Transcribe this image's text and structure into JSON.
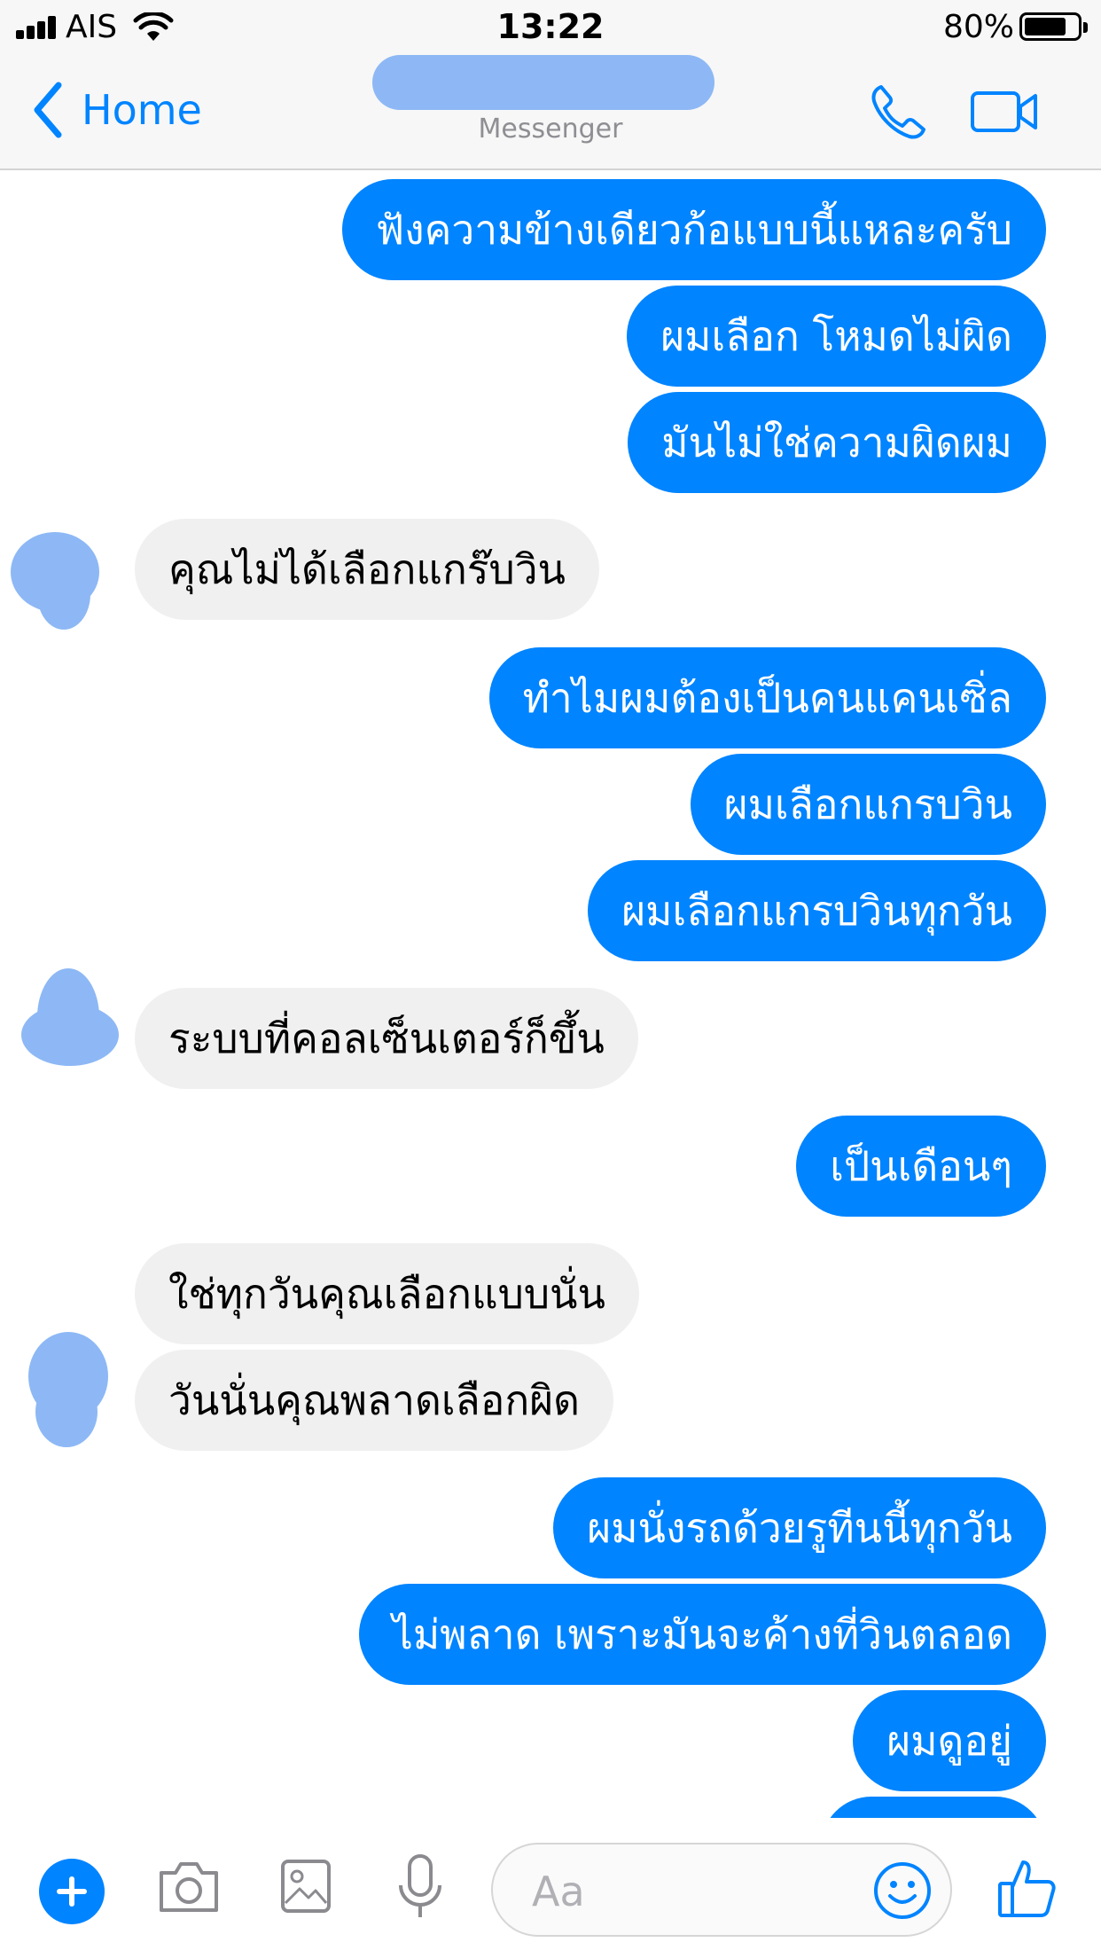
{
  "status_bar": {
    "carrier": "AIS",
    "time": "13:22",
    "battery_percent": "80%",
    "battery_level": 0.8
  },
  "nav": {
    "back_label": "Home",
    "subtitle": "Messenger"
  },
  "messages": [
    {
      "side": "out",
      "text": "ฟังความข้างเดียวก้อแบบนี้แหละครับ"
    },
    {
      "side": "out",
      "text": "ผมเลือก โหมดไม่ผิด"
    },
    {
      "side": "out",
      "text": "มันไม่ใช่ความผิดผม"
    },
    {
      "side": "in",
      "text": "คุณไม่ได้เลือกแกร๊บวิน"
    },
    {
      "side": "out",
      "text": "ทำไมผมต้องเป็นคนแคนเซิ่ล"
    },
    {
      "side": "out",
      "text": "ผมเลือกแกรบวิน"
    },
    {
      "side": "out",
      "text": "ผมเลือกแกรบวินทุกวัน"
    },
    {
      "side": "in",
      "text": "ระบบที่คอลเซ็นเตอร์ก็ขึ้น"
    },
    {
      "side": "out",
      "text": "เป็นเดือนๆ"
    },
    {
      "side": "in",
      "text": "ใช่ทุกวันคุณเลือกแบบนั่น"
    },
    {
      "side": "in",
      "text": "วันนั่นคุณพลาดเลือกผิด"
    },
    {
      "side": "out",
      "text": "ผมนั่งรถด้วยรูทีนนี้ทุกวัน"
    },
    {
      "side": "out",
      "text": "ไม่พลาด เพราะมันจะค้างที่วินตลอด"
    },
    {
      "side": "out",
      "text": "ผมดูอยู่"
    }
  ],
  "composer": {
    "placeholder": "Aa"
  },
  "colors": {
    "accent": "#0084ff",
    "incoming_bubble": "#f1f0f0",
    "redaction": "#8db8f5"
  },
  "icons": [
    "signal-icon",
    "wifi-icon",
    "battery-icon",
    "back-chevron-icon",
    "phone-icon",
    "video-icon",
    "plus-icon",
    "camera-icon",
    "image-icon",
    "microphone-icon",
    "smile-icon",
    "thumbs-up-icon"
  ]
}
